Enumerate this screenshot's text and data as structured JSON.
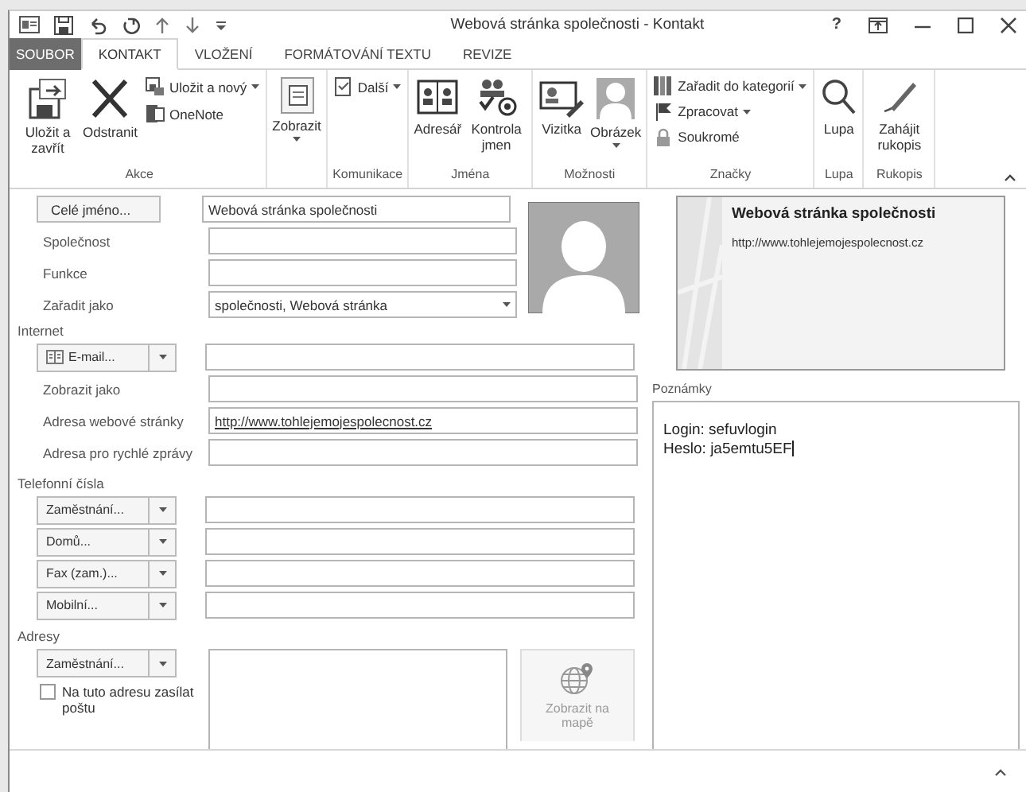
{
  "window": {
    "title": "Webová stránka společnosti - Kontakt",
    "help": "?"
  },
  "tabs": [
    {
      "label": "SOUBOR",
      "kind": "file",
      "selected": false
    },
    {
      "label": "KONTAKT",
      "kind": "tab",
      "selected": true
    },
    {
      "label": "VLOŽENÍ",
      "kind": "tab",
      "selected": false
    },
    {
      "label": "FORMÁTOVÁNÍ TEXTU",
      "kind": "tab",
      "selected": false
    },
    {
      "label": "REVIZE",
      "kind": "tab",
      "selected": false
    }
  ],
  "ribbon": [
    {
      "label": "Akce",
      "items": [
        {
          "kind": "large",
          "label": "Uložit a zavřít",
          "dropdown": false
        },
        {
          "kind": "large",
          "label": "Odstranit",
          "dropdown": false
        },
        {
          "kind": "stack",
          "items": [
            {
              "label": "Uložit a nový",
              "dropdown": true
            },
            {
              "label": "OneNote",
              "dropdown": false
            }
          ]
        }
      ]
    },
    {
      "items": [
        {
          "kind": "large",
          "label": "Zobrazit",
          "dropdown": true
        }
      ]
    },
    {
      "label": "Komunikace",
      "items": [
        {
          "kind": "stack",
          "items": [
            {
              "label": "Další",
              "dropdown": true
            }
          ]
        }
      ]
    },
    {
      "label": "Jména",
      "items": [
        {
          "kind": "large",
          "label": "Adresář",
          "dropdown": false
        },
        {
          "kind": "large",
          "label": "Kontrola jmen",
          "dropdown": false
        }
      ]
    },
    {
      "label": "Možnosti",
      "items": [
        {
          "kind": "large",
          "label": "Vizitka",
          "dropdown": false
        },
        {
          "kind": "large",
          "label": "Obrázek",
          "dropdown": true
        }
      ]
    },
    {
      "label": "Značky",
      "items": [
        {
          "kind": "stack",
          "items": [
            {
              "label": "Zařadit do kategorií",
              "dropdown": true
            },
            {
              "label": "Zpracovat",
              "dropdown": true
            },
            {
              "label": "Soukromé",
              "dropdown": false
            }
          ]
        }
      ]
    },
    {
      "label": "Lupa",
      "items": [
        {
          "kind": "large",
          "label": "Lupa",
          "dropdown": false
        }
      ]
    },
    {
      "label": "Rukopis",
      "items": [
        {
          "kind": "large",
          "label": "Zahájit rukopis",
          "dropdown": false
        }
      ]
    }
  ],
  "name_block": [
    {
      "kind": "button",
      "label": "Celé jméno...",
      "value": "Webová stránka společnosti"
    },
    {
      "kind": "text",
      "label": "Společnost"
    },
    {
      "kind": "text",
      "label": "Funkce"
    },
    {
      "kind": "select",
      "label": "Zařadit jako",
      "value": "společnosti, Webová stránka"
    }
  ],
  "sections": [
    {
      "title": "Internet",
      "rows": [
        {
          "kind": "email",
          "label": "E-mail..."
        },
        {
          "kind": "text",
          "label": "Zobrazit jako"
        },
        {
          "kind": "link",
          "label": "Adresa webové stránky",
          "value": "http://www.tohlejemojespolecnost.cz"
        },
        {
          "kind": "text",
          "label": "Adresa pro rychlé zprávy"
        }
      ]
    },
    {
      "title": "Telefonní čísla",
      "rows": [
        {
          "kind": "dropdown",
          "label": "Zaměstnání..."
        },
        {
          "kind": "dropdown",
          "label": "Domů..."
        },
        {
          "kind": "dropdown",
          "label": "Fax (zam.)..."
        },
        {
          "kind": "dropdown",
          "label": "Mobilní..."
        }
      ]
    }
  ],
  "addresses": {
    "title": "Adresy",
    "type_button": "Zaměstnání...",
    "mail_checkbox": {
      "label": "Na tuto adresu zasílat poštu",
      "checked": false
    },
    "map_button": {
      "label": "Zobrazit na mapě",
      "disabled": true
    }
  },
  "business_card": {
    "name": "Webová stránka společnosti",
    "url": "http://www.tohlejemojespolecnost.cz"
  },
  "notes": {
    "label": "Poznámky",
    "lines": [
      "Login: sefuvlogin",
      "Heslo: ja5emtu5EF"
    ]
  }
}
